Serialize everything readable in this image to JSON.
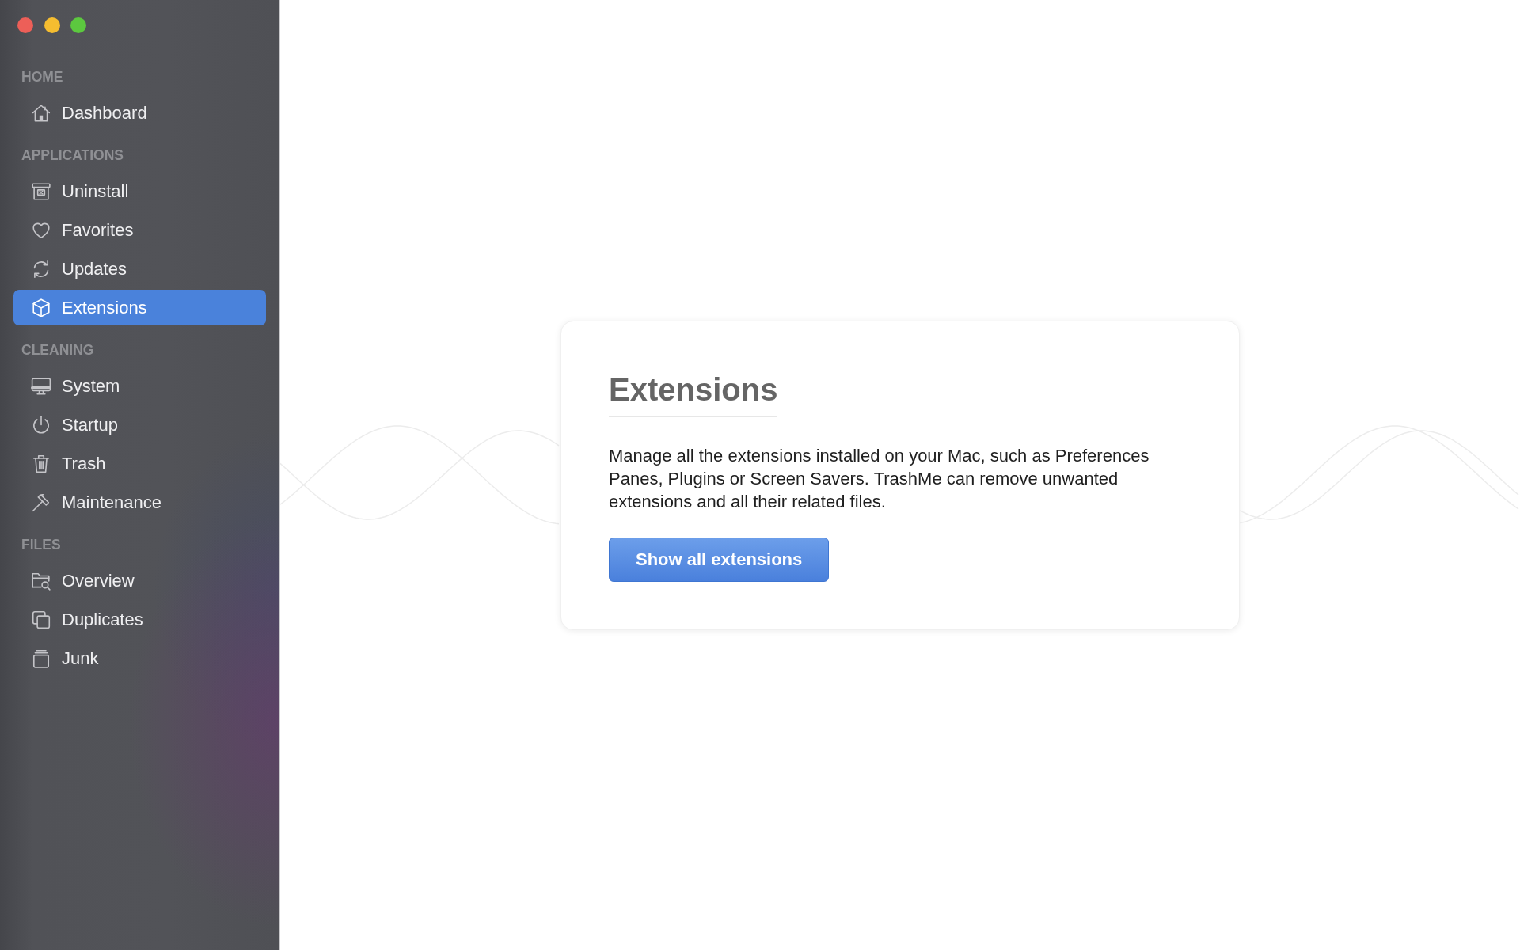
{
  "sidebar": {
    "sections": [
      {
        "title": "HOME",
        "items": [
          {
            "label": "Dashboard",
            "selected": false
          }
        ]
      },
      {
        "title": "APPLICATIONS",
        "items": [
          {
            "label": "Uninstall",
            "selected": false
          },
          {
            "label": "Favorites",
            "selected": false
          },
          {
            "label": "Updates",
            "selected": false
          },
          {
            "label": "Extensions",
            "selected": true
          }
        ]
      },
      {
        "title": "CLEANING",
        "items": [
          {
            "label": "System",
            "selected": false
          },
          {
            "label": "Startup",
            "selected": false
          },
          {
            "label": "Trash",
            "selected": false
          },
          {
            "label": "Maintenance",
            "selected": false
          }
        ]
      },
      {
        "title": "FILES",
        "items": [
          {
            "label": "Overview",
            "selected": false
          },
          {
            "label": "Duplicates",
            "selected": false
          },
          {
            "label": "Junk",
            "selected": false
          }
        ]
      }
    ]
  },
  "card": {
    "title": "Extensions",
    "description": "Manage all the extensions installed on your Mac, such as Preferences Panes, Plugins or Screen Savers. TrashMe can remove unwanted extensions and all their related files.",
    "button": "Show all extensions"
  }
}
